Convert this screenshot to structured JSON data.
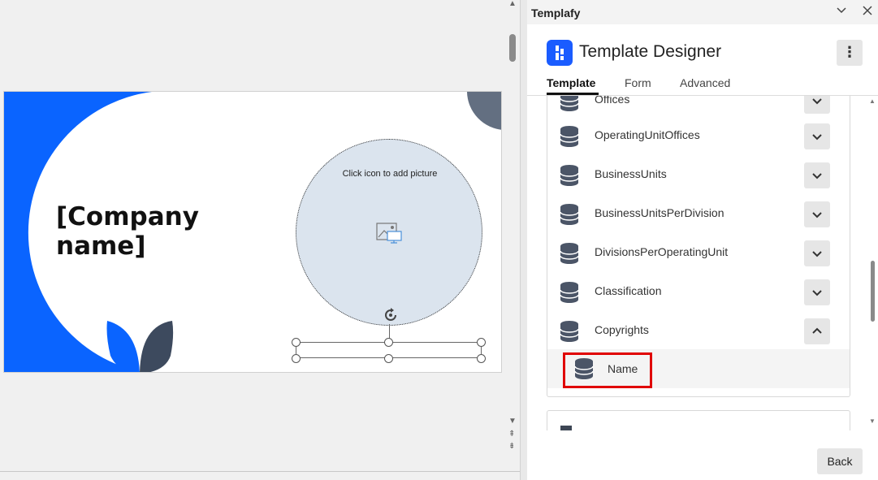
{
  "slide": {
    "company_placeholder": "[Company\nname]",
    "picture_placeholder_text": "Click icon to add picture"
  },
  "pane": {
    "title": "Templafy",
    "header_title": "Template Designer",
    "more_label": "⋮",
    "tabs": [
      "Template",
      "Form",
      "Advanced"
    ],
    "active_tab": "Template",
    "data_sources": [
      {
        "label": "Offices",
        "expanded": false
      },
      {
        "label": "OperatingUnitOffices",
        "expanded": false
      },
      {
        "label": "BusinessUnits",
        "expanded": false
      },
      {
        "label": "BusinessUnitsPerDivision",
        "expanded": false
      },
      {
        "label": "DivisionsPerOperatingUnit",
        "expanded": false
      },
      {
        "label": "Classification",
        "expanded": false
      },
      {
        "label": "Copyrights",
        "expanded": true
      }
    ],
    "copyrights_fields": [
      {
        "label": "Name",
        "highlighted": true
      }
    ],
    "back_label": "Back"
  },
  "colors": {
    "brand_blue": "#0a64ff",
    "slate": "#3d4a5e",
    "highlight_red": "#e00000",
    "placeholder_fill": "#dbe4ee"
  },
  "icons": {
    "data_source": "database-icon",
    "collapse": "chevron-down-icon",
    "expand": "chevron-up-icon",
    "picture": "insert-picture-icon"
  }
}
